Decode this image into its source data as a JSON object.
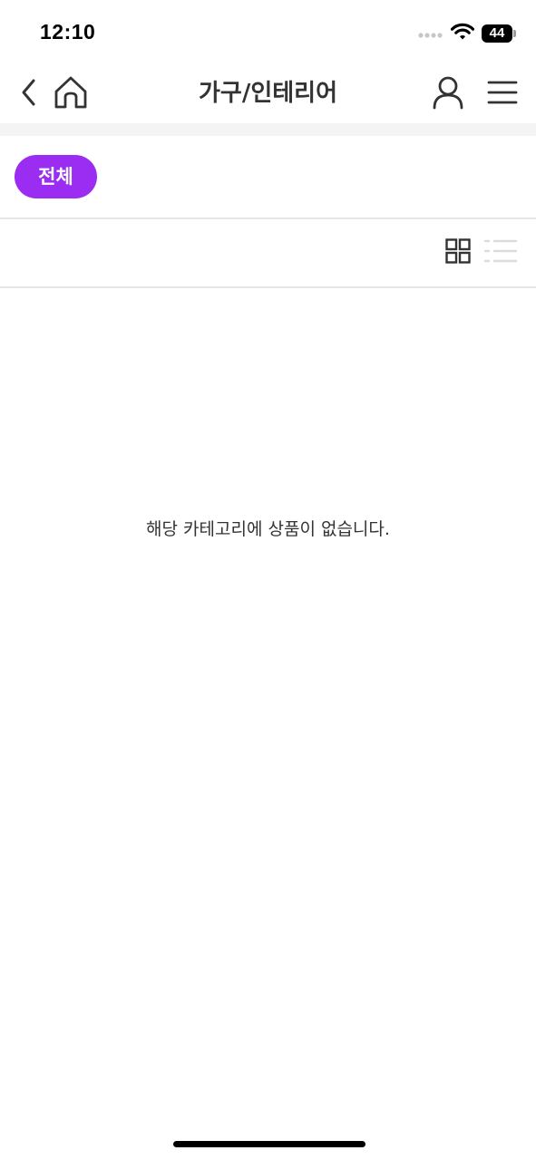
{
  "status_bar": {
    "time": "12:10",
    "battery_level": "44",
    "icons": [
      "signal-icon",
      "wifi-icon",
      "battery-icon"
    ]
  },
  "header": {
    "title": "가구/인테리어",
    "icons": [
      "back-icon",
      "home-icon",
      "user-icon",
      "menu-icon"
    ]
  },
  "categories": {
    "items": [
      {
        "label": "전체",
        "selected": true
      }
    ]
  },
  "view_toggle": {
    "active": "grid",
    "icons": [
      "grid-view-icon",
      "list-view-icon"
    ]
  },
  "content": {
    "empty_message": "해당 카테고리에 상품이 없습니다."
  },
  "colors": {
    "accent": "#9b2cf2",
    "divider": "#e6e6e6",
    "section_bg": "#f4f4f4",
    "text": "#333333"
  }
}
